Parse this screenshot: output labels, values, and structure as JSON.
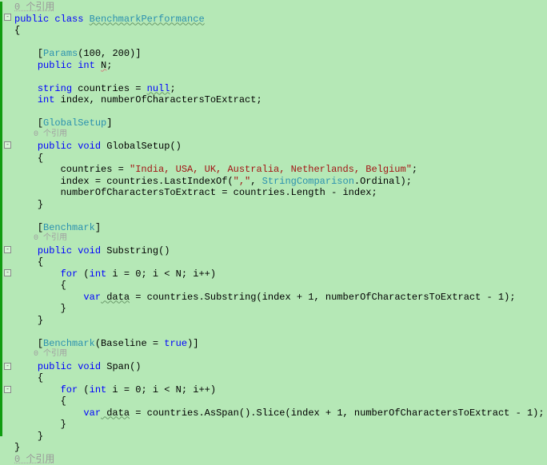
{
  "refs_faded": "0 个引用",
  "refs": "0 个引用",
  "l1": {
    "kw1": "public",
    "kw2": "class",
    "name": "BenchmarkPerformance"
  },
  "l2": "{",
  "l4": {
    "open": "[",
    "attr": "Params",
    "args": "(100, 200)]"
  },
  "l5": {
    "kw1": "public",
    "kw2": "int",
    "name": "N",
    "end": ";"
  },
  "l7": {
    "kw": "string",
    "name": " countries = ",
    "val": "null",
    "end": ";"
  },
  "l8": {
    "kw": "int",
    "rest": " index, numberOfCharactersToExtract;"
  },
  "l10": {
    "open": "[",
    "attr": "GlobalSetup",
    "close": "]"
  },
  "l11": {
    "kw1": "public",
    "kw2": "void",
    "name": "GlobalSetup",
    "args": "()"
  },
  "l12": "{",
  "l13": {
    "a": "countries = ",
    "str": "\"India, USA, UK, Australia, Netherlands, Belgium\"",
    "end": ";"
  },
  "l14": {
    "a": "index = countries.",
    "m": "LastIndexOf",
    "b": "(",
    "str": "\",\"",
    "c": ", ",
    "enm": "StringComparison",
    "d": ".Ordinal);"
  },
  "l15": "numberOfCharactersToExtract = countries.Length - index;",
  "l16": "}",
  "l18": {
    "open": "[",
    "attr": "Benchmark",
    "close": "]"
  },
  "l20": {
    "kw1": "public",
    "kw2": "void",
    "name": "Substring",
    "args": "()"
  },
  "l21": "{",
  "l22": {
    "kw": "for",
    "a": " (",
    "kw2": "int",
    "b": " i = 0; i < N; i++)"
  },
  "l23": "{",
  "l24": {
    "kw": "var",
    "v": " data",
    "a": " = countries.",
    "m": "Substring",
    "b": "(index + 1, numberOfCharactersToExtract - 1);"
  },
  "l25": "}",
  "l26": "}",
  "l28": {
    "open": "[",
    "attr": "Benchmark",
    "args": "(Baseline = ",
    "kw": "true",
    "close": ")]"
  },
  "l30": {
    "kw1": "public",
    "kw2": "void",
    "name": "Span",
    "args": "()"
  },
  "l31": "{",
  "l32": {
    "kw": "for",
    "a": " (",
    "kw2": "int",
    "b": " i = 0; i < N; i++)"
  },
  "l33": "{",
  "l34": {
    "kw": "var",
    "v": " data",
    "a": " = countries.",
    "m": "AsSpan",
    "b": "().",
    "m2": "Slice",
    "c": "(index + 1, numberOfCharactersToExtract - 1);"
  },
  "l35": "}",
  "l36": "}",
  "l37": "}"
}
